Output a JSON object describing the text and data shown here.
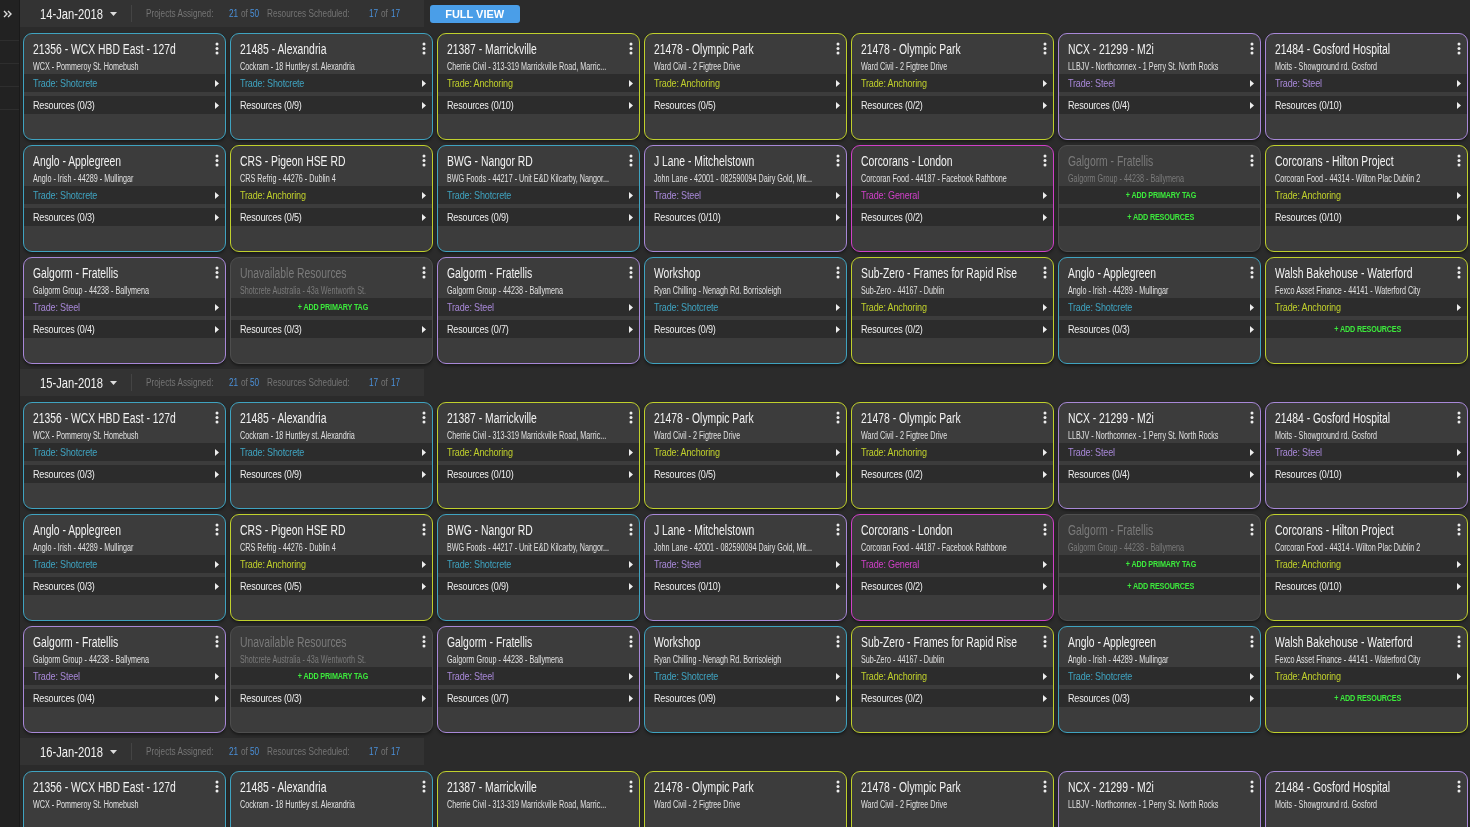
{
  "sidebar": {
    "collapsed": true
  },
  "sections": [
    {
      "date": "14-Jan-2018",
      "stats": [
        {
          "label": "Projects Assigned:",
          "value": "21",
          "of": "of",
          "total": "50"
        },
        {
          "label": "Resources Scheduled:",
          "value": "17",
          "of": "of",
          "total": "17"
        }
      ],
      "button": "FULL VIEW",
      "cards": [
        {
          "title": "21356 - WCX HBD East - 127d",
          "subtitle": "WCX - Pommeroy St. Homebush",
          "color": "#3fa3c0",
          "disabled": false,
          "rows": [
            {
              "kind": "trade",
              "text": "Trade: Shotcrete"
            },
            {
              "kind": "resources",
              "text": "Resources (0/3)"
            }
          ]
        },
        {
          "title": "21485 - Alexandria",
          "subtitle": "Cockram - 18 Huntley st. Alexandria",
          "color": "#3fa3c0",
          "disabled": false,
          "rows": [
            {
              "kind": "trade",
              "text": "Trade: Shotcrete"
            },
            {
              "kind": "resources",
              "text": "Resources (0/9)"
            }
          ]
        },
        {
          "title": "21387 - Marrickville",
          "subtitle": "Cherrie Civil - 313-319 Marrickville Road, Marric...",
          "color": "#c0d02c",
          "disabled": false,
          "rows": [
            {
              "kind": "trade",
              "text": "Trade: Anchoring"
            },
            {
              "kind": "resources",
              "text": "Resources (0/10)"
            }
          ]
        },
        {
          "title": "21478 - Olympic Park",
          "subtitle": "Ward Civil - 2 Figtree Drive",
          "color": "#c0d02c",
          "disabled": false,
          "rows": [
            {
              "kind": "trade",
              "text": "Trade: Anchoring"
            },
            {
              "kind": "resources",
              "text": "Resources (0/5)"
            }
          ]
        },
        {
          "title": "21478 - Olympic Park",
          "subtitle": "Ward Civil - 2 Figtree Drive",
          "color": "#c0d02c",
          "disabled": false,
          "rows": [
            {
              "kind": "trade",
              "text": "Trade: Anchoring"
            },
            {
              "kind": "resources",
              "text": "Resources (0/2)"
            }
          ]
        },
        {
          "title": "NCX - 21299 - M2i",
          "subtitle": "LLBJV - Northconnex - 1 Perry St. North Rocks",
          "color": "#a888d8",
          "disabled": false,
          "rows": [
            {
              "kind": "trade",
              "text": "Trade: Steel"
            },
            {
              "kind": "resources",
              "text": "Resources (0/4)"
            }
          ]
        },
        {
          "title": "21484 - Gosford Hospital",
          "subtitle": "Moits - Showground rd. Gosford",
          "color": "#a888d8",
          "disabled": false,
          "rows": [
            {
              "kind": "trade",
              "text": "Trade: Steel"
            },
            {
              "kind": "resources",
              "text": "Resources (0/10)"
            }
          ]
        },
        {
          "title": "Anglo - Applegreen",
          "subtitle": "Anglo - Irish - 44289 - Mullingar",
          "color": "#3fa3c0",
          "disabled": false,
          "rows": [
            {
              "kind": "trade",
              "text": "Trade: Shotcrete"
            },
            {
              "kind": "resources",
              "text": "Resources (0/3)"
            }
          ]
        },
        {
          "title": "CRS - Pigeon HSE RD",
          "subtitle": "CRS Refrig - 44276 - Dublin 4",
          "color": "#c0d02c",
          "disabled": false,
          "rows": [
            {
              "kind": "trade",
              "text": "Trade: Anchoring"
            },
            {
              "kind": "resources",
              "text": "Resources (0/5)"
            }
          ]
        },
        {
          "title": "BWG - Nangor RD",
          "subtitle": "BWG Foods - 44217 - Unit E&D Kilcarby, Nangor...",
          "color": "#3fa3c0",
          "disabled": false,
          "rows": [
            {
              "kind": "trade",
              "text": "Trade: Shotcrete"
            },
            {
              "kind": "resources",
              "text": "Resources (0/9)"
            }
          ]
        },
        {
          "title": "J Lane - Mitchelstown",
          "subtitle": "John Lane - 42001 - 082590094 Dairy Gold, Mit...",
          "color": "#a888d8",
          "disabled": false,
          "rows": [
            {
              "kind": "trade",
              "text": "Trade: Steel"
            },
            {
              "kind": "resources",
              "text": "Resources (0/10)"
            }
          ]
        },
        {
          "title": "Corcorans - London",
          "subtitle": "Corcoran Food - 44187 - Facebook Rathbone",
          "color": "#d040c8",
          "disabled": false,
          "rows": [
            {
              "kind": "trade",
              "text": "Trade: General"
            },
            {
              "kind": "resources",
              "text": "Resources (0/2)"
            }
          ]
        },
        {
          "title": "Galgorm - Fratellis",
          "subtitle": "Galgorm Group - 44238 - Ballymena",
          "disabled": true,
          "rows": [
            {
              "kind": "add",
              "text": "+ ADD PRIMARY TAG"
            },
            {
              "kind": "add",
              "text": "+ ADD RESOURCES"
            }
          ]
        },
        {
          "title": "Corcorans - Hilton Project",
          "subtitle": "Corcoran Food - 44314 - Wilton Plac Dublin 2",
          "color": "#c0d02c",
          "disabled": false,
          "rows": [
            {
              "kind": "trade",
              "text": "Trade: Anchoring"
            },
            {
              "kind": "resources",
              "text": "Resources (0/10)"
            }
          ]
        },
        {
          "title": "Galgorm - Fratellis",
          "subtitle": "Galgorm Group - 44238 - Ballymena",
          "color": "#a888d8",
          "disabled": false,
          "rows": [
            {
              "kind": "trade",
              "text": "Trade: Steel"
            },
            {
              "kind": "resources",
              "text": "Resources (0/4)"
            }
          ]
        },
        {
          "title": "Unavailable Resources",
          "subtitle": "Shotcrete Australia - 43a Wentworth St.",
          "disabled": true,
          "rows": [
            {
              "kind": "add",
              "text": "+ ADD PRIMARY TAG"
            },
            {
              "kind": "resources",
              "text": "Resources (0/3)"
            }
          ]
        },
        {
          "title": "Galgorm - Fratellis",
          "subtitle": "Galgorm Group - 44238 - Ballymena",
          "color": "#a888d8",
          "disabled": false,
          "rows": [
            {
              "kind": "trade",
              "text": "Trade: Steel"
            },
            {
              "kind": "resources",
              "text": "Resources (0/7)"
            }
          ]
        },
        {
          "title": "Workshop",
          "subtitle": "Ryan Chilling - Nenagh Rd. Borrisoleigh",
          "color": "#3fa3c0",
          "disabled": false,
          "rows": [
            {
              "kind": "trade",
              "text": "Trade: Shotcrete"
            },
            {
              "kind": "resources",
              "text": "Resources (0/9)"
            }
          ]
        },
        {
          "title": "Sub-Zero - Frames for Rapid Rise",
          "subtitle": "Sub-Zero - 44167 - Dublin",
          "color": "#c0d02c",
          "disabled": false,
          "rows": [
            {
              "kind": "trade",
              "text": "Trade: Anchoring"
            },
            {
              "kind": "resources",
              "text": "Resources (0/2)"
            }
          ]
        },
        {
          "title": "Anglo - Applegreen",
          "subtitle": "Anglo - Irish - 44289 - Mullingar",
          "color": "#3fa3c0",
          "disabled": false,
          "rows": [
            {
              "kind": "trade",
              "text": "Trade: Shotcrete"
            },
            {
              "kind": "resources",
              "text": "Resources (0/3)"
            }
          ]
        },
        {
          "title": "Walsh Bakehouse - Waterford",
          "subtitle": "Fexco Asset Finance - 44141 - Waterford City",
          "color": "#c0d02c",
          "disabled": false,
          "rows": [
            {
              "kind": "trade",
              "text": "Trade: Anchoring"
            },
            {
              "kind": "add",
              "text": "+ ADD RESOURCES"
            }
          ]
        }
      ]
    },
    {
      "date": "15-Jan-2018",
      "stats": [
        {
          "label": "Projects Assigned:",
          "value": "21",
          "of": "of",
          "total": "50"
        },
        {
          "label": "Resources Scheduled:",
          "value": "17",
          "of": "of",
          "total": "17"
        }
      ],
      "cards": [
        {
          "title": "21356 - WCX HBD East - 127d",
          "subtitle": "WCX - Pommeroy St. Homebush",
          "color": "#3fa3c0",
          "disabled": false,
          "rows": [
            {
              "kind": "trade",
              "text": "Trade: Shotcrete"
            },
            {
              "kind": "resources",
              "text": "Resources (0/3)"
            }
          ]
        },
        {
          "title": "21485 - Alexandria",
          "subtitle": "Cockram - 18 Huntley st. Alexandria",
          "color": "#3fa3c0",
          "disabled": false,
          "rows": [
            {
              "kind": "trade",
              "text": "Trade: Shotcrete"
            },
            {
              "kind": "resources",
              "text": "Resources (0/9)"
            }
          ]
        },
        {
          "title": "21387 - Marrickville",
          "subtitle": "Cherrie Civil - 313-319 Marrickville Road, Marric...",
          "color": "#c0d02c",
          "disabled": false,
          "rows": [
            {
              "kind": "trade",
              "text": "Trade: Anchoring"
            },
            {
              "kind": "resources",
              "text": "Resources (0/10)"
            }
          ]
        },
        {
          "title": "21478 - Olympic Park",
          "subtitle": "Ward Civil - 2 Figtree Drive",
          "color": "#c0d02c",
          "disabled": false,
          "rows": [
            {
              "kind": "trade",
              "text": "Trade: Anchoring"
            },
            {
              "kind": "resources",
              "text": "Resources (0/5)"
            }
          ]
        },
        {
          "title": "21478 - Olympic Park",
          "subtitle": "Ward Civil - 2 Figtree Drive",
          "color": "#c0d02c",
          "disabled": false,
          "rows": [
            {
              "kind": "trade",
              "text": "Trade: Anchoring"
            },
            {
              "kind": "resources",
              "text": "Resources (0/2)"
            }
          ]
        },
        {
          "title": "NCX - 21299 - M2i",
          "subtitle": "LLBJV - Northconnex - 1 Perry St. North Rocks",
          "color": "#a888d8",
          "disabled": false,
          "rows": [
            {
              "kind": "trade",
              "text": "Trade: Steel"
            },
            {
              "kind": "resources",
              "text": "Resources (0/4)"
            }
          ]
        },
        {
          "title": "21484 - Gosford Hospital",
          "subtitle": "Moits - Showground rd. Gosford",
          "color": "#a888d8",
          "disabled": false,
          "rows": [
            {
              "kind": "trade",
              "text": "Trade: Steel"
            },
            {
              "kind": "resources",
              "text": "Resources (0/10)"
            }
          ]
        },
        {
          "title": "Anglo - Applegreen",
          "subtitle": "Anglo - Irish - 44289 - Mullingar",
          "color": "#3fa3c0",
          "disabled": false,
          "rows": [
            {
              "kind": "trade",
              "text": "Trade: Shotcrete"
            },
            {
              "kind": "resources",
              "text": "Resources (0/3)"
            }
          ]
        },
        {
          "title": "CRS - Pigeon HSE RD",
          "subtitle": "CRS Refrig - 44276 - Dublin 4",
          "color": "#c0d02c",
          "disabled": false,
          "rows": [
            {
              "kind": "trade",
              "text": "Trade: Anchoring"
            },
            {
              "kind": "resources",
              "text": "Resources (0/5)"
            }
          ]
        },
        {
          "title": "BWG - Nangor RD",
          "subtitle": "BWG Foods - 44217 - Unit E&D Kilcarby, Nangor...",
          "color": "#3fa3c0",
          "disabled": false,
          "rows": [
            {
              "kind": "trade",
              "text": "Trade: Shotcrete"
            },
            {
              "kind": "resources",
              "text": "Resources (0/9)"
            }
          ]
        },
        {
          "title": "J Lane - Mitchelstown",
          "subtitle": "John Lane - 42001 - 082590094 Dairy Gold, Mit...",
          "color": "#a888d8",
          "disabled": false,
          "rows": [
            {
              "kind": "trade",
              "text": "Trade: Steel"
            },
            {
              "kind": "resources",
              "text": "Resources (0/10)"
            }
          ]
        },
        {
          "title": "Corcorans - London",
          "subtitle": "Corcoran Food - 44187 - Facebook Rathbone",
          "color": "#d040c8",
          "disabled": false,
          "rows": [
            {
              "kind": "trade",
              "text": "Trade: General"
            },
            {
              "kind": "resources",
              "text": "Resources (0/2)"
            }
          ]
        },
        {
          "title": "Galgorm - Fratellis",
          "subtitle": "Galgorm Group - 44238 - Ballymena",
          "disabled": true,
          "rows": [
            {
              "kind": "add",
              "text": "+ ADD PRIMARY TAG"
            },
            {
              "kind": "add",
              "text": "+ ADD RESOURCES"
            }
          ]
        },
        {
          "title": "Corcorans - Hilton Project",
          "subtitle": "Corcoran Food - 44314 - Wilton Plac Dublin 2",
          "color": "#c0d02c",
          "disabled": false,
          "rows": [
            {
              "kind": "trade",
              "text": "Trade: Anchoring"
            },
            {
              "kind": "resources",
              "text": "Resources (0/10)"
            }
          ]
        },
        {
          "title": "Galgorm - Fratellis",
          "subtitle": "Galgorm Group - 44238 - Ballymena",
          "color": "#a888d8",
          "disabled": false,
          "rows": [
            {
              "kind": "trade",
              "text": "Trade: Steel"
            },
            {
              "kind": "resources",
              "text": "Resources (0/4)"
            }
          ]
        },
        {
          "title": "Unavailable Resources",
          "subtitle": "Shotcrete Australia - 43a Wentworth St.",
          "disabled": true,
          "rows": [
            {
              "kind": "add",
              "text": "+ ADD PRIMARY TAG"
            },
            {
              "kind": "resources",
              "text": "Resources (0/3)"
            }
          ]
        },
        {
          "title": "Galgorm - Fratellis",
          "subtitle": "Galgorm Group - 44238 - Ballymena",
          "color": "#a888d8",
          "disabled": false,
          "rows": [
            {
              "kind": "trade",
              "text": "Trade: Steel"
            },
            {
              "kind": "resources",
              "text": "Resources (0/7)"
            }
          ]
        },
        {
          "title": "Workshop",
          "subtitle": "Ryan Chilling - Nenagh Rd. Borrisoleigh",
          "color": "#3fa3c0",
          "disabled": false,
          "rows": [
            {
              "kind": "trade",
              "text": "Trade: Shotcrete"
            },
            {
              "kind": "resources",
              "text": "Resources (0/9)"
            }
          ]
        },
        {
          "title": "Sub-Zero - Frames for Rapid Rise",
          "subtitle": "Sub-Zero - 44167 - Dublin",
          "color": "#c0d02c",
          "disabled": false,
          "rows": [
            {
              "kind": "trade",
              "text": "Trade: Anchoring"
            },
            {
              "kind": "resources",
              "text": "Resources (0/2)"
            }
          ]
        },
        {
          "title": "Anglo - Applegreen",
          "subtitle": "Anglo - Irish - 44289 - Mullingar",
          "color": "#3fa3c0",
          "disabled": false,
          "rows": [
            {
              "kind": "trade",
              "text": "Trade: Shotcrete"
            },
            {
              "kind": "resources",
              "text": "Resources (0/3)"
            }
          ]
        },
        {
          "title": "Walsh Bakehouse - Waterford",
          "subtitle": "Fexco Asset Finance - 44141 - Waterford City",
          "color": "#c0d02c",
          "disabled": false,
          "rows": [
            {
              "kind": "trade",
              "text": "Trade: Anchoring"
            },
            {
              "kind": "add",
              "text": "+ ADD RESOURCES"
            }
          ]
        }
      ]
    },
    {
      "date": "16-Jan-2018",
      "stats": [
        {
          "label": "Projects Assigned:",
          "value": "21",
          "of": "of",
          "total": "50"
        },
        {
          "label": "Resources Scheduled:",
          "value": "17",
          "of": "of",
          "total": "17"
        }
      ],
      "cards": [
        {
          "title": "21356 - WCX HBD East - 127d",
          "subtitle": "WCX - Pommeroy St. Homebush",
          "color": "#3fa3c0",
          "disabled": false
        },
        {
          "title": "21485 - Alexandria",
          "subtitle": "Cockram - 18 Huntley st. Alexandria",
          "color": "#3fa3c0",
          "disabled": false
        },
        {
          "title": "21387 - Marrickville",
          "subtitle": "Cherrie Civil - 313-319 Marrickville Road, Marric...",
          "color": "#c0d02c",
          "disabled": false
        },
        {
          "title": "21478 - Olympic Park",
          "subtitle": "Ward Civil - 2 Figtree Drive",
          "color": "#c0d02c",
          "disabled": false
        },
        {
          "title": "21478 - Olympic Park",
          "subtitle": "Ward Civil - 2 Figtree Drive",
          "color": "#c0d02c",
          "disabled": false
        },
        {
          "title": "NCX - 21299 - M2i",
          "subtitle": "LLBJV - Northconnex - 1 Perry St. North Rocks",
          "color": "#a888d8",
          "disabled": false
        },
        {
          "title": "21484 - Gosford Hospital",
          "subtitle": "Moits - Showground rd. Gosford",
          "color": "#a888d8",
          "disabled": false
        }
      ]
    }
  ]
}
